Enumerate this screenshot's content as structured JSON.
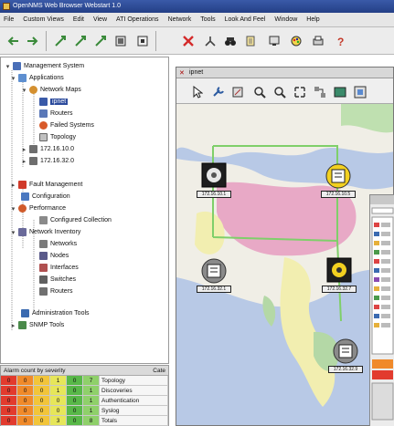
{
  "window": {
    "title": "OpenNMS Web Browser Webstart 1.0"
  },
  "menu": [
    "File",
    "Custom Views",
    "Edit",
    "View",
    "ATI Operations",
    "Network",
    "Tools",
    "Look And Feel",
    "Window",
    "Help"
  ],
  "tree": {
    "root": "Management System",
    "items": [
      {
        "label": "Applications"
      },
      {
        "label": "Network Maps"
      },
      {
        "label": "ipnet"
      },
      {
        "label": "Routers"
      },
      {
        "label": "Failed Systems"
      },
      {
        "label": "Topology"
      },
      {
        "label": "172.16.10.0"
      },
      {
        "label": "172.16.32.0"
      },
      {
        "label": "Fault Management"
      },
      {
        "label": "Configuration"
      },
      {
        "label": "Performance"
      },
      {
        "label": "Configured Collection"
      },
      {
        "label": "Network Inventory"
      },
      {
        "label": "Networks"
      },
      {
        "label": "Nodes"
      },
      {
        "label": "Interfaces"
      },
      {
        "label": "Switches"
      },
      {
        "label": "Routers"
      },
      {
        "label": "Administration Tools"
      },
      {
        "label": "SNMP Tools"
      }
    ]
  },
  "alarms": {
    "header_left": "Alarm count by severity",
    "header_right": "Cate",
    "rows": [
      {
        "values": [
          "0",
          "0",
          "0",
          "1",
          "0",
          "7"
        ],
        "label": "Topology"
      },
      {
        "values": [
          "0",
          "0",
          "0",
          "1",
          "0",
          "1"
        ],
        "label": "Discoveries"
      },
      {
        "values": [
          "0",
          "0",
          "0",
          "0",
          "0",
          "1"
        ],
        "label": "Authentication"
      },
      {
        "values": [
          "0",
          "0",
          "0",
          "0",
          "0",
          "1"
        ],
        "label": "Syslog"
      },
      {
        "values": [
          "0",
          "0",
          "0",
          "3",
          "0",
          "8"
        ],
        "label": "Totals"
      }
    ],
    "severity_colors": [
      "#e23b2e",
      "#f08a2a",
      "#f2c53a",
      "#e6e65a",
      "#58b848",
      "#8fd06a"
    ]
  },
  "map_window": {
    "title": "ipnet"
  },
  "map_nodes": [
    {
      "label": "172.16.10.1",
      "kind": "server-dark"
    },
    {
      "label": "172.16.10.5",
      "kind": "router-yellow"
    },
    {
      "label": "172.16.32.1",
      "kind": "router-gray"
    },
    {
      "label": "172.16.32.7",
      "kind": "server-yellow"
    },
    {
      "label": "172.16.32.9",
      "kind": "router-gray"
    }
  ],
  "colors": {
    "accent": "#2b4a9c",
    "link": "#7fcf6a",
    "ocean": "#b8c9e6"
  }
}
